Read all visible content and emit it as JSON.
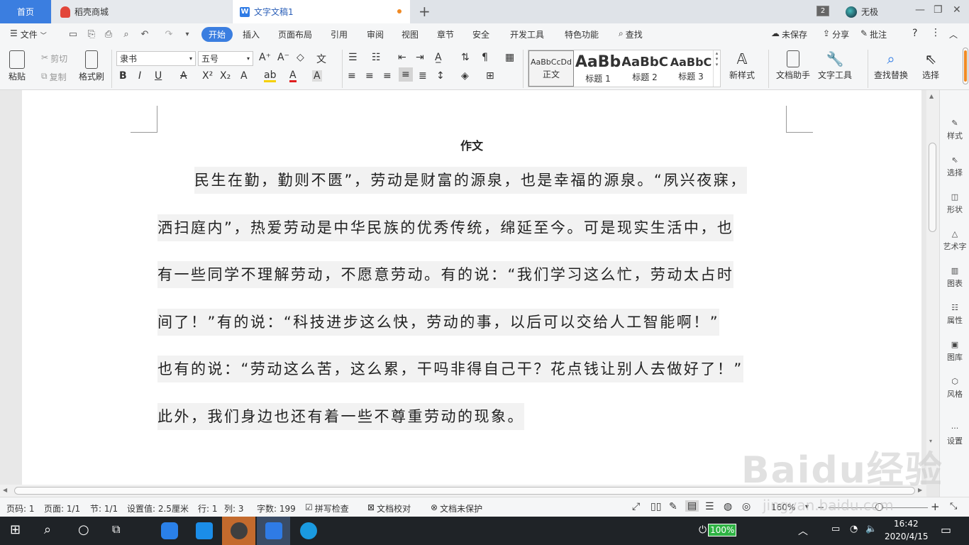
{
  "tabs": {
    "home": "首页",
    "store": "稻壳商城",
    "document": "文字文稿1",
    "new_tab": "+",
    "window_count": "2",
    "user": "无极"
  },
  "menu": {
    "file": "文件",
    "items": [
      "开始",
      "插入",
      "页面布局",
      "引用",
      "审阅",
      "视图",
      "章节",
      "安全",
      "开发工具",
      "特色功能"
    ],
    "search": "查找",
    "unsaved": "未保存",
    "share": "分享",
    "comment": "批注",
    "help": "?"
  },
  "ribbon": {
    "paste": "粘贴",
    "cut": "剪切",
    "copy": "复制",
    "format_painter": "格式刷",
    "font_name": "隶书",
    "font_size": "五号",
    "styles": [
      {
        "sample": "AaBbCcDd",
        "label": "正文"
      },
      {
        "sample": "AaBb",
        "label": "标题 1"
      },
      {
        "sample": "AaBbC",
        "label": "标题 2"
      },
      {
        "sample": "AaBbC",
        "label": "标题 3"
      }
    ],
    "new_style": "新样式",
    "doc_assistant": "文档助手",
    "text_tools": "文字工具",
    "find_replace": "查找替换",
    "select": "选择"
  },
  "document": {
    "title": "作文",
    "lines": [
      "民生在勤，勤则不匮”，劳动是财富的源泉，也是幸福的源泉。“夙兴夜寐，",
      "洒扫庭内”，热爱劳动是中华民族的优秀传统，绵延至今。可是现实生活中，也",
      "有一些同学不理解劳动，不愿意劳动。有的说：“我们学习这么忙，劳动太占时",
      "间了！”有的说：“科技进步这么快，劳动的事，以后可以交给人工智能啊！”",
      "也有的说：“劳动这么苦，这么累，干吗非得自己干？花点钱让别人去做好了！”",
      "此外，我们身边也还有着一些不尊重劳动的现象。"
    ]
  },
  "sidepanel": [
    "样式",
    "选择",
    "形状",
    "艺术字",
    "图表",
    "属性",
    "图库",
    "风格",
    "设置"
  ],
  "status": {
    "page": "页码: 1",
    "pages": "页面: 1/1",
    "section": "节: 1/1",
    "setting": "设置值: 2.5厘米",
    "row": "行: 1",
    "col": "列: 3",
    "words": "字数: 199",
    "spell": "拼写检查",
    "proof": "文档校对",
    "protect": "文档未保护",
    "zoom": "160%"
  },
  "taskbar": {
    "battery": "100%",
    "time": "16:42",
    "date": "2020/4/15"
  },
  "watermark": {
    "main": "Baidu经验",
    "sub": "jingyan.baidu.com"
  }
}
